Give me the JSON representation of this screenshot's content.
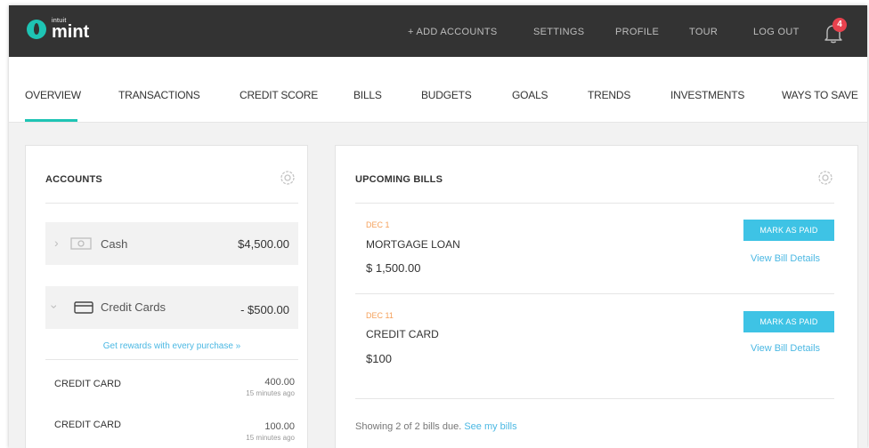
{
  "brand": {
    "intuit": "intuit",
    "mint": "mint"
  },
  "topnav": {
    "add_accounts": "+ ADD ACCOUNTS",
    "settings": "SETTINGS",
    "profile": "PROFILE",
    "tour": "TOUR",
    "logout": "LOG OUT",
    "notifications_count": "4"
  },
  "tabs": [
    {
      "label": "OVERVIEW",
      "active": true
    },
    {
      "label": "TRANSACTIONS"
    },
    {
      "label": "CREDIT SCORE"
    },
    {
      "label": "BILLS"
    },
    {
      "label": "BUDGETS"
    },
    {
      "label": "GOALS"
    },
    {
      "label": "TRENDS"
    },
    {
      "label": "INVESTMENTS"
    },
    {
      "label": "WAYS TO SAVE"
    }
  ],
  "accounts": {
    "title": "ACCOUNTS",
    "cash": {
      "label": "Cash",
      "amount": "$4,500.00"
    },
    "credit_cards": {
      "label": "Credit Cards",
      "amount": "- $500.00",
      "rewards_link": "Get rewards with every purchase »",
      "items": [
        {
          "name": "CREDIT CARD",
          "amount": "400.00",
          "updated": "15 minutes ago"
        },
        {
          "name": "CREDIT CARD",
          "amount": "100.00",
          "updated": "15 minutes ago"
        }
      ]
    }
  },
  "bills": {
    "title": "UPCOMING BILLS",
    "items": [
      {
        "date": "DEC 1",
        "name": "MORTGAGE LOAN",
        "amount": "$ 1,500.00",
        "action": "MARK AS PAID",
        "details_link": "View Bill Details"
      },
      {
        "date": "DEC 11",
        "name": "CREDIT CARD",
        "amount": "$100",
        "action": "MARK AS PAID",
        "details_link": "View Bill Details"
      }
    ],
    "footer_text": "Showing 2 of 2 bills due.",
    "footer_link": "See my bills"
  },
  "colors": {
    "accent": "#1ec4b4",
    "button": "#3ec3e5",
    "link": "#4bb8e3",
    "date": "#f5a05a",
    "badge": "#e8424e",
    "topbar": "#333333"
  }
}
